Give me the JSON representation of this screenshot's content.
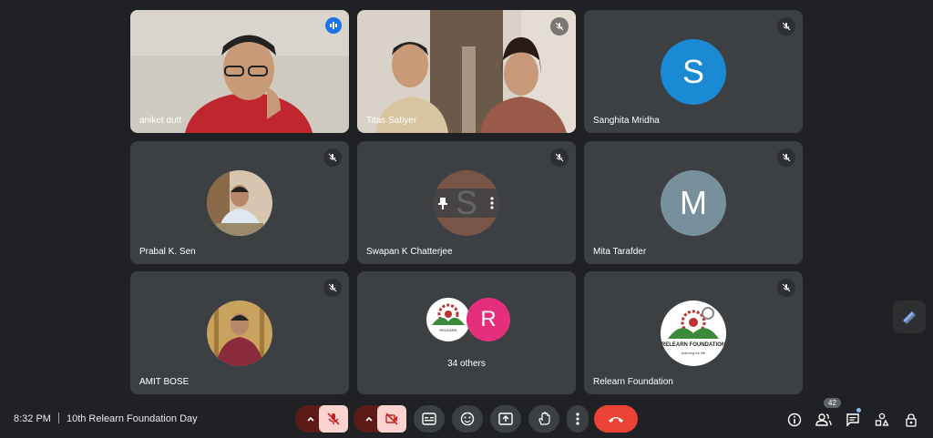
{
  "participants": [
    {
      "name": "aniket dutt",
      "type": "video"
    },
    {
      "name": "Titas Satiyer",
      "type": "video"
    },
    {
      "name": "Sanghita Mridha",
      "type": "initial",
      "initial": "S",
      "color": "#1a8ad4"
    },
    {
      "name": "Prabal K. Sen",
      "type": "photo"
    },
    {
      "name": "Swapan K Chatterjee",
      "type": "initial",
      "initial": "S",
      "color": "#795548"
    },
    {
      "name": "Mita Tarafder",
      "type": "initial",
      "initial": "M",
      "color": "#78909c"
    },
    {
      "name": "AMIT BOSE",
      "type": "photo"
    },
    {
      "name": "34 others",
      "type": "group",
      "initial": "R",
      "color": "#e52f7c"
    },
    {
      "name": "Relearn Foundation",
      "type": "logo",
      "logo_text": "RELEARN FOUNDATION",
      "logo_sub": "learning for life"
    }
  ],
  "meeting": {
    "time": "8:32 PM",
    "title": "10th Relearn Foundation Day"
  },
  "people_count": "42",
  "icons": {
    "mic_off": "mic-off-icon",
    "camera_off": "camera-off-icon",
    "captions": "captions-icon",
    "emoji": "emoji-icon",
    "present": "present-icon",
    "hand": "raise-hand-icon",
    "more": "more-vert-icon",
    "leave": "call-end-icon",
    "info": "info-icon",
    "people": "people-icon",
    "chat": "chat-icon",
    "activities": "activities-icon",
    "host": "host-controls-icon"
  },
  "colors": {
    "accent": "#8ab4f8",
    "danger": "#ea4335",
    "background": "#202124",
    "tile": "#3c4043"
  }
}
